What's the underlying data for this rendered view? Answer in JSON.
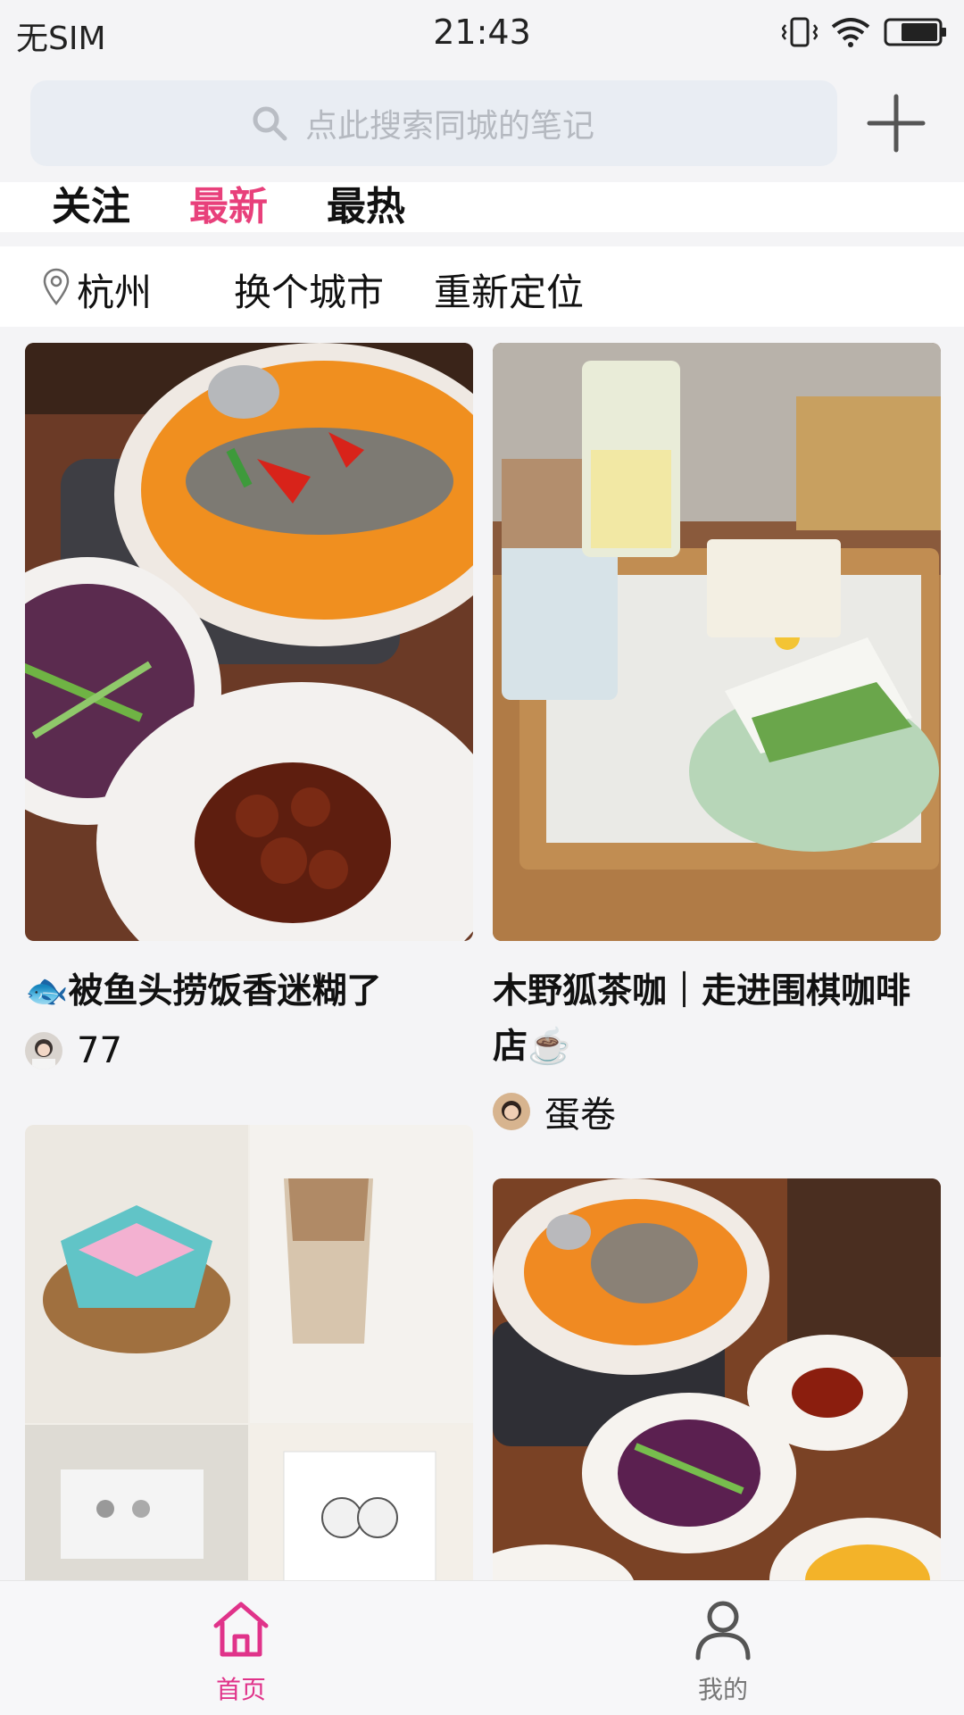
{
  "status_bar": {
    "carrier": "无SIM",
    "time": "21:43"
  },
  "search": {
    "placeholder": "点此搜索同城的笔记"
  },
  "tabs": [
    {
      "label": "关注",
      "active": false
    },
    {
      "label": "最新",
      "active": true
    },
    {
      "label": "最热",
      "active": false
    }
  ],
  "location": {
    "city": "杭州",
    "change_city": "换个城市",
    "relocate": "重新定位"
  },
  "feed": {
    "cards": [
      {
        "title": "🐟被鱼头捞饭香迷糊了",
        "author": "77",
        "image": "fish-head-pot-dinner-photo"
      },
      {
        "title": "木野狐茶咖｜走进围棋咖啡店☕️",
        "author": "蛋卷",
        "image": "iced-latte-and-matcha-cake-photo"
      },
      {
        "title": "",
        "author": "",
        "image": "cake-and-coffee-collage-photo"
      },
      {
        "title": "",
        "author": "",
        "image": "fish-head-pot-table-photo"
      }
    ]
  },
  "bottom_nav": {
    "home_label": "首页",
    "mine_label": "我的"
  },
  "colors": {
    "accent": "#e8407b",
    "nav_active": "#e0338a"
  }
}
